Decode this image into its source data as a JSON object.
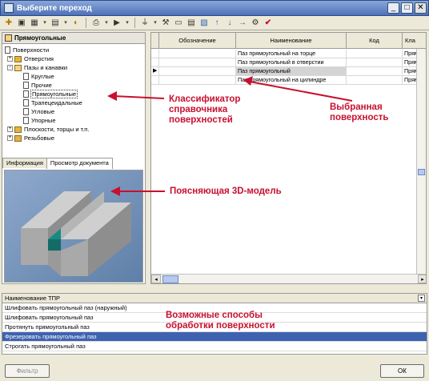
{
  "window": {
    "title": "Выберите переход",
    "min": "_",
    "max": "□",
    "close": "✕"
  },
  "toolbar": {
    "icons": [
      "new-icon",
      "folder-icon",
      "grid-icon",
      "list-icon",
      "run-icon",
      "print-icon",
      "play-icon",
      "filter-icon",
      "tools-icon",
      "copy-icon",
      "paste-icon",
      "image-icon",
      "up-icon",
      "down-icon",
      "right-icon",
      "link-icon",
      "star-icon",
      "check-icon"
    ],
    "glyphs": {
      "new": "✚",
      "folder": "▣",
      "grid": "▦",
      "dd": "▾",
      "list": "▤",
      "run": "◐",
      "print": "⎙",
      "play": "▶",
      "filter": "⏚",
      "tools": "⚒",
      "copy": "▭",
      "paste": "▤",
      "image": "▧",
      "up": "↑",
      "down": "↓",
      "right": "→",
      "link": "⚙",
      "check": "✔"
    }
  },
  "tree": {
    "header": "Прямоугольные",
    "nodes": {
      "root": "Поверхности",
      "holes": "Отверстия",
      "grooves": "Пазы и канавки",
      "round": "Круглые",
      "other": "Прочие",
      "rect": "Прямоугольные",
      "trap": "Трапецеидальные",
      "angular": "Угловые",
      "stop": "Упорные",
      "planes": "Плоскости, торцы и т.п.",
      "thread": "Резьбовые"
    },
    "plus": "+",
    "minus": "−"
  },
  "tabs": {
    "info": "Информация",
    "preview": "Просмотр документа"
  },
  "grid": {
    "columns": {
      "marker": "",
      "designation": "Обозначение",
      "name": "Наименование",
      "code": "Код",
      "class": "Кла"
    },
    "rows": [
      {
        "name": "Паз прямоугольный на торце",
        "class": "Прям"
      },
      {
        "name": "Паз прямоугольный в отверстии",
        "class": "Прям"
      },
      {
        "name": "Паз прямоугольный",
        "class": "Прям",
        "marker": "▶"
      },
      {
        "name": "Паз прямоугольный на цилиндре",
        "class": "Прям"
      }
    ]
  },
  "bottom": {
    "header": "Наименование ТПР",
    "rows": [
      "Шлифовать прямоугольный паз (наружный)",
      "Шлифовать прямоугольный паз",
      "Протянуть прямоугольный паз",
      "Фрезеровать прямоугольный паз",
      "Строгать прямоугольный паз"
    ],
    "selected_index": 3
  },
  "buttons": {
    "filter": "Фильтр",
    "ok": "ОК"
  },
  "callouts": {
    "classifier": "Классификатор справочника поверхностей",
    "selected": "Выбранная поверхность",
    "model": "Поясняющая 3D-модель",
    "methods": "Возможные способы обработки поверхности"
  },
  "colors": {
    "accent": "#c8102e",
    "selection": "#3d63b0",
    "slot": "#1a8a84"
  }
}
